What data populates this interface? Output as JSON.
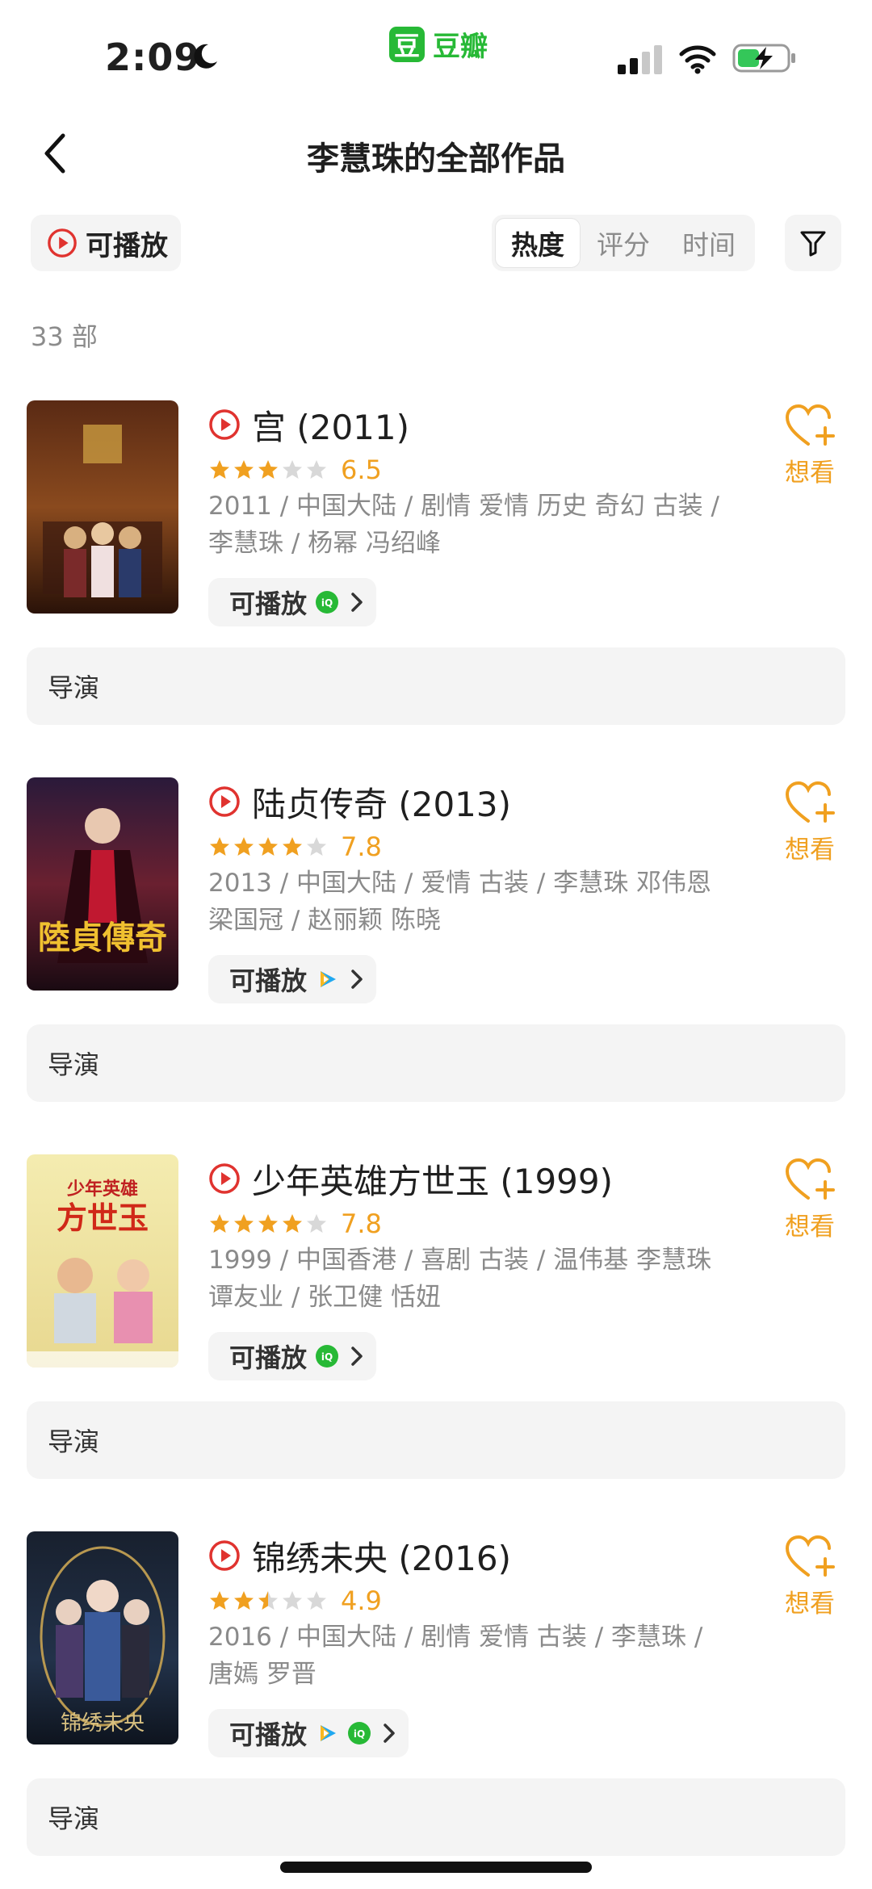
{
  "status_bar": {
    "time": "2:09",
    "app_name": "豆瓣",
    "app_logo_char": "豆"
  },
  "nav": {
    "title": "李慧珠的全部作品"
  },
  "toolbar": {
    "playable_label": "可播放",
    "sort_tabs": [
      {
        "label": "热度",
        "active": true
      },
      {
        "label": "评分",
        "active": false
      },
      {
        "label": "时间",
        "active": false
      }
    ]
  },
  "count_text": "33 部",
  "colors": {
    "accent": "#f0a020",
    "play_red": "#e0332f",
    "brand_green": "#27b936"
  },
  "items": [
    {
      "title": "宫 (2011)",
      "rating": 6.5,
      "rating_text": "6.5",
      "stars": 3,
      "meta": "2011 / 中国大陆 / 剧情 爱情 历史 奇幻 古装 / 李慧珠 / 杨幂 冯绍峰",
      "play_label": "可播放",
      "sources": [
        "iqiyi-icon"
      ],
      "want_label": "想看",
      "role": "导演"
    },
    {
      "title": "陆贞传奇 (2013)",
      "rating": 7.8,
      "rating_text": "7.8",
      "stars": 4,
      "meta": "2013 / 中国大陆 / 爱情 古装 / 李慧珠 邓伟恩 梁国冠 / 赵丽颖 陈晓",
      "play_label": "可播放",
      "sources": [
        "tencent-video-icon"
      ],
      "want_label": "想看",
      "role": "导演"
    },
    {
      "title": "少年英雄方世玉 (1999)",
      "rating": 7.8,
      "rating_text": "7.8",
      "stars": 4,
      "meta": "1999 / 中国香港 / 喜剧 古装 / 温伟基 李慧珠 谭友业 / 张卫健 恬妞",
      "play_label": "可播放",
      "sources": [
        "iqiyi-icon"
      ],
      "want_label": "想看",
      "role": "导演"
    },
    {
      "title": "锦绣未央 (2016)",
      "rating": 4.9,
      "rating_text": "4.9",
      "stars": 2.5,
      "meta": "2016 / 中国大陆 / 剧情 爱情 古装 / 李慧珠 / 唐嫣 罗晋",
      "play_label": "可播放",
      "sources": [
        "tencent-video-icon",
        "iqiyi-icon"
      ],
      "want_label": "想看",
      "role": "导演"
    }
  ]
}
